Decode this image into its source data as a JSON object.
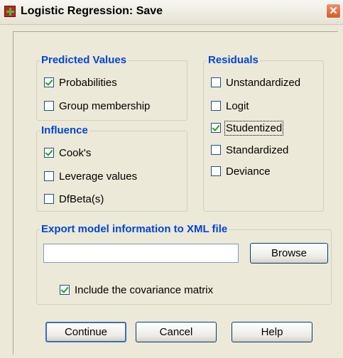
{
  "window": {
    "title": "Logistic Regression: Save",
    "close_glyph": "✕",
    "app_icon": "spss-dialog-icon"
  },
  "predicted_values": {
    "title": "Predicted Values",
    "items": [
      {
        "label": "Probabilities",
        "checked": true
      },
      {
        "label": "Group membership",
        "checked": false
      }
    ]
  },
  "influence": {
    "title": "Influence",
    "items": [
      {
        "label": "Cook's",
        "checked": true
      },
      {
        "label": "Leverage values",
        "checked": false
      },
      {
        "label": "DfBeta(s)",
        "checked": false
      }
    ]
  },
  "residuals": {
    "title": "Residuals",
    "items": [
      {
        "label": "Unstandardized",
        "checked": false
      },
      {
        "label": "Logit",
        "checked": false
      },
      {
        "label": "Studentized",
        "checked": true
      },
      {
        "label": "Standardized",
        "checked": false
      },
      {
        "label": "Deviance",
        "checked": false
      }
    ]
  },
  "export": {
    "title": "Export model information to XML file",
    "file_path": "",
    "browse_label": "Browse",
    "include_cov_label": "Include the covariance matrix",
    "include_cov_checked": true
  },
  "buttons": {
    "continue": "Continue",
    "cancel": "Cancel",
    "help": "Help"
  },
  "colors": {
    "group_title": "#0046d5",
    "background": "#ece9d8",
    "close_button": "#d55a2c"
  }
}
